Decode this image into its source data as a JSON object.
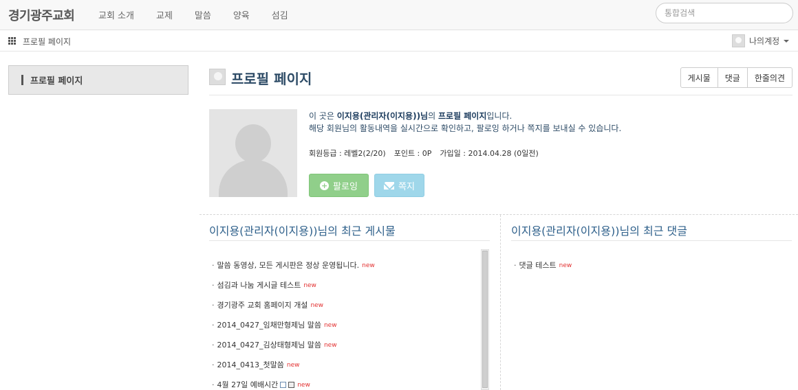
{
  "navbar": {
    "brand": "경기광주교회",
    "menu": [
      "교회 소개",
      "교제",
      "말씀",
      "양육",
      "섬김"
    ],
    "search_placeholder": "통합검색"
  },
  "subbar": {
    "title": "프로필 페이지",
    "account_label": "나의계정"
  },
  "sidebar": {
    "items": [
      {
        "label": "프로필 페이지"
      }
    ]
  },
  "main": {
    "title": "프로필 페이지",
    "buttons": [
      "게시물",
      "댓글",
      "한줄의견"
    ]
  },
  "profile": {
    "intro_prefix": "이 곳은 ",
    "intro_name": "이지용(관리자(이지용))님",
    "intro_mid": "의 ",
    "intro_page": "프로필 페이지",
    "intro_suffix": "입니다.",
    "intro_line2": "해당 회원님의 활동내역을 실시간으로 확인하고, 팔로잉 하거나 쪽지를 보내실 수 있습니다.",
    "level": "회원등급 : 레벨2(2/20)",
    "points": "포인트 : 0P",
    "joined": "가입일 : 2014.04.28 (0일전)",
    "follow_label": "팔로잉",
    "message_label": "쪽지"
  },
  "recent_posts": {
    "title": "이지용(관리자(이지용))님의 최근 게시물",
    "new_label": "new",
    "items": [
      {
        "text": "말씀 동영상, 모든 게시판은 정상 운영됩니다."
      },
      {
        "text": "섬김과 나눔 게시글 테스트"
      },
      {
        "text": "경기광주 교회 홈페이지 개설"
      },
      {
        "text": "2014_0427_임채만형제님 말씀"
      },
      {
        "text": "2014_0427_김상태형제님 말씀"
      },
      {
        "text": "2014_0413_첫말씀"
      },
      {
        "text": "4월 27일 예배시간"
      }
    ]
  },
  "recent_comments": {
    "title": "이지용(관리자(이지용))님의 최근 댓글",
    "items": [
      {
        "text": "댓글 테스트"
      }
    ]
  }
}
